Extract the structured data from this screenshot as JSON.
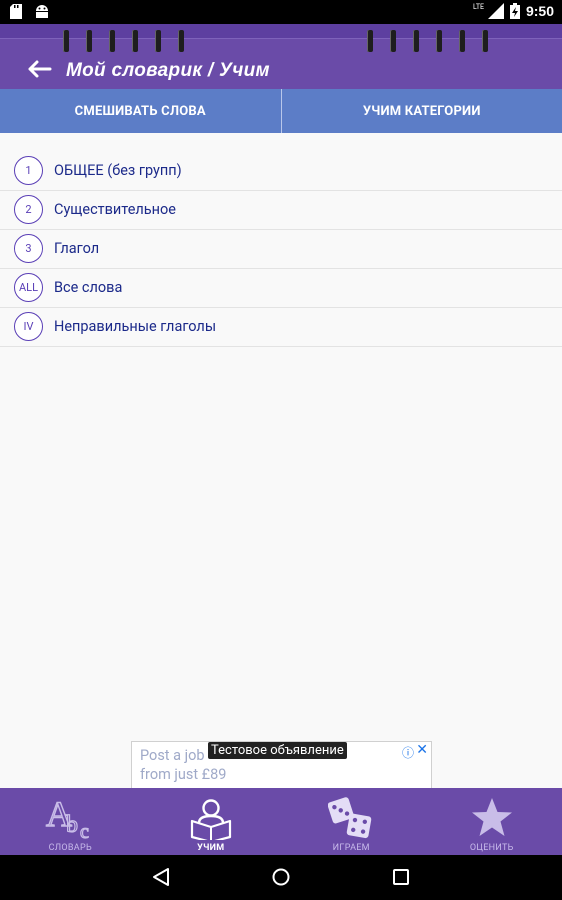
{
  "status_bar": {
    "network": "LTE",
    "time": "9:50"
  },
  "header": {
    "title": "Мой словарик / Учим"
  },
  "tabs": [
    {
      "label": "СМЕШИВАТЬ СЛОВА"
    },
    {
      "label": "УЧИМ КАТЕГОРИИ"
    }
  ],
  "categories": [
    {
      "badge": "1",
      "label": "ОБЩЕЕ (без групп)"
    },
    {
      "badge": "2",
      "label": "Существительное"
    },
    {
      "badge": "3",
      "label": "Глагол"
    },
    {
      "badge": "ALL",
      "label": "Все слова"
    },
    {
      "badge": "IV",
      "label": "Неправильные глаголы"
    }
  ],
  "ad": {
    "label": "Тестовое объявление",
    "line1": "Post a job",
    "line2": "from just £89"
  },
  "bottom_nav": [
    {
      "label": "СЛОВАРЬ",
      "icon": "abc-icon"
    },
    {
      "label": "УЧИМ",
      "icon": "reader-icon"
    },
    {
      "label": "ИГРАЕМ",
      "icon": "dice-icon"
    },
    {
      "label": "ОЦЕНИТЬ",
      "icon": "star-icon"
    }
  ],
  "colors": {
    "header": "#6a4ba8",
    "tabs": "#5c7dc7",
    "accent": "#5a3fb6",
    "list_text": "#1c2a8a"
  }
}
